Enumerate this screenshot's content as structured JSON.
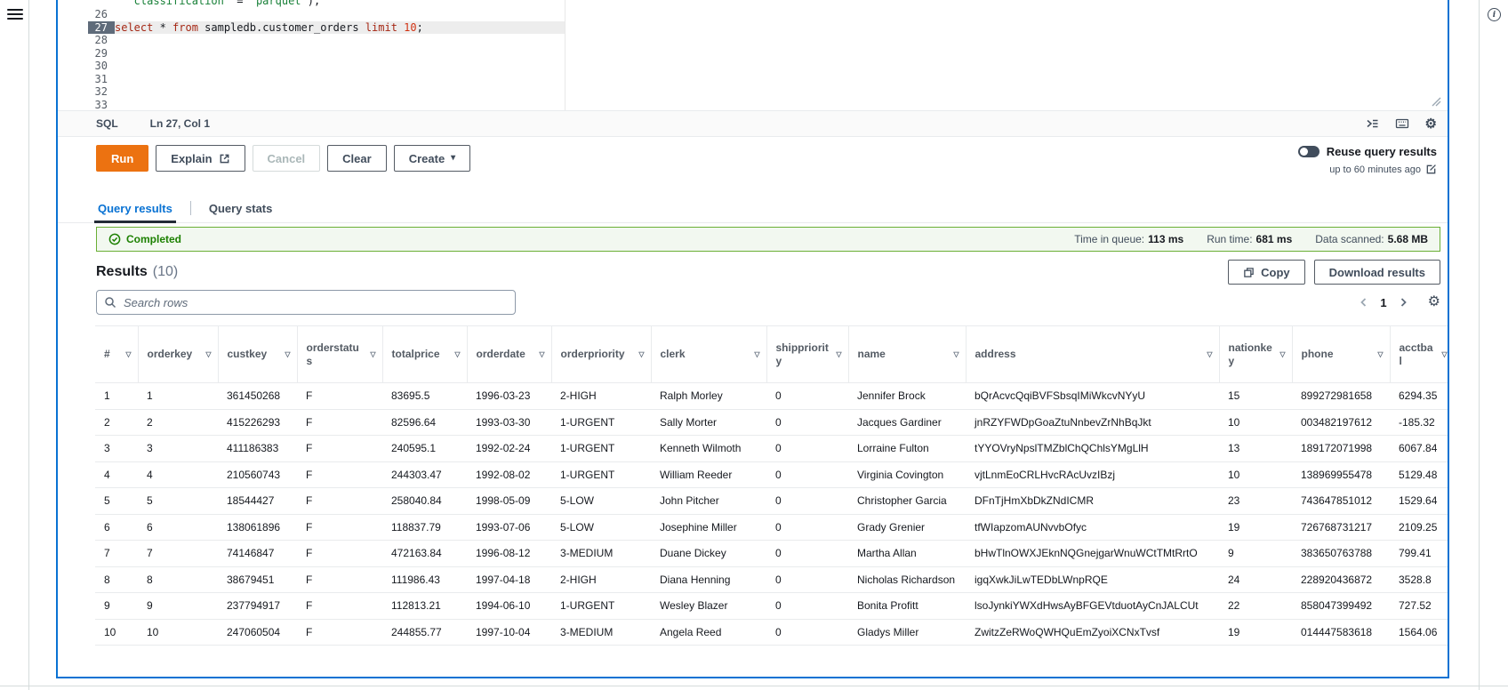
{
  "icons": {
    "settings_gear": "⚙",
    "column_filter": "▽",
    "caret_down": "▾",
    "info": "i"
  },
  "colors": {
    "panel_focus_blue": "#0972d3",
    "run_button_orange": "#ec7211",
    "success_green": "#1d8102",
    "active_tab_blue": "#0972d3",
    "sql_keyword": "#a52714",
    "sql_string": "#188038",
    "sql_number": "#d13212"
  },
  "editor": {
    "partial_line_tokens": [
      {
        "c": "str",
        "v": "  'classification'"
      },
      {
        "c": "pl",
        "v": " = "
      },
      {
        "c": "str",
        "v": "'parquet'"
      },
      {
        "c": "pl",
        "v": ");"
      }
    ],
    "line_before": "26",
    "active_line_number": "27",
    "active_line_tokens": [
      {
        "c": "kw",
        "v": "select"
      },
      {
        "c": "pl",
        "v": " * "
      },
      {
        "c": "kw",
        "v": "from"
      },
      {
        "c": "pl",
        "v": " sampledb.customer_orders "
      },
      {
        "c": "kw",
        "v": "limit"
      },
      {
        "c": "pl",
        "v": " "
      },
      {
        "c": "num",
        "v": "10"
      },
      {
        "c": "pl",
        "v": ";"
      }
    ],
    "lines_below": [
      "28",
      "29",
      "30",
      "31",
      "32",
      "33"
    ],
    "statusbar": {
      "language": "SQL",
      "cursor_position": "Ln 27, Col 1"
    }
  },
  "actions": {
    "run": "Run",
    "explain": "Explain",
    "cancel": "Cancel",
    "clear": "Clear",
    "create": "Create",
    "reuse_label": "Reuse query results",
    "reuse_sublabel": "up to 60 minutes ago"
  },
  "tabs": {
    "query_results": "Query results",
    "query_stats": "Query stats"
  },
  "banner": {
    "status": "Completed",
    "stats": [
      {
        "label": "Time in queue:",
        "value": "113 ms"
      },
      {
        "label": "Run time:",
        "value": "681 ms"
      },
      {
        "label": "Data scanned:",
        "value": "5.68 MB"
      }
    ]
  },
  "results": {
    "title": "Results",
    "count": "(10)",
    "copy": "Copy",
    "download": "Download results",
    "search_placeholder": "Search rows",
    "page": "1"
  },
  "table": {
    "columns": [
      "#",
      "orderkey",
      "custkey",
      "orderstatus",
      "totalprice",
      "orderdate",
      "orderpriority",
      "clerk",
      "shippriority",
      "name",
      "address",
      "nationkey",
      "phone",
      "acctbal"
    ],
    "rows": [
      [
        "1",
        "1",
        "361450268",
        "F",
        "83695.5",
        "1996-03-23",
        "2-HIGH",
        "Ralph Morley",
        "0",
        "Jennifer Brock",
        "bQrAcvcQqiBVFSbsqIMiWkcvNYyU",
        "15",
        "899272981658",
        "6294.35"
      ],
      [
        "2",
        "2",
        "415226293",
        "F",
        "82596.64",
        "1993-03-30",
        "1-URGENT",
        "Sally Morter",
        "0",
        "Jacques Gardiner",
        "jnRZYFWDpGoaZtuNnbevZrNhBqJkt",
        "10",
        "003482197612",
        "-185.32"
      ],
      [
        "3",
        "3",
        "411186383",
        "F",
        "240595.1",
        "1992-02-24",
        "1-URGENT",
        "Kenneth Wilmoth",
        "0",
        "Lorraine Fulton",
        "tYYOVryNpslTMZblChQChlsYMgLlH",
        "13",
        "189172071998",
        "6067.84"
      ],
      [
        "4",
        "4",
        "210560743",
        "F",
        "244303.47",
        "1992-08-02",
        "1-URGENT",
        "William Reeder",
        "0",
        "Virginia Covington",
        "vjtLnmEoCRLHvcRAcUvzIBzj",
        "10",
        "138969955478",
        "5129.48"
      ],
      [
        "5",
        "5",
        "18544427",
        "F",
        "258040.84",
        "1998-05-09",
        "5-LOW",
        "John Pitcher",
        "0",
        "Christopher Garcia",
        "DFnTjHmXbDkZNdICMR",
        "23",
        "743647851012",
        "1529.64"
      ],
      [
        "6",
        "6",
        "138061896",
        "F",
        "118837.79",
        "1993-07-06",
        "5-LOW",
        "Josephine Miller",
        "0",
        "Grady Grenier",
        "tfWIapzomAUNvvbOfyc",
        "19",
        "726768731217",
        "2109.25"
      ],
      [
        "7",
        "7",
        "74146847",
        "F",
        "472163.84",
        "1996-08-12",
        "3-MEDIUM",
        "Duane Dickey",
        "0",
        "Martha Allan",
        "bHwTlnOWXJEknNQGnejgarWnuWCtTMtRrtO",
        "9",
        "383650763788",
        "799.41"
      ],
      [
        "8",
        "8",
        "38679451",
        "F",
        "111986.43",
        "1997-04-18",
        "2-HIGH",
        "Diana Henning",
        "0",
        "Nicholas Richardson",
        "igqXwkJiLwTEDbLWnpRQE",
        "24",
        "228920436872",
        "3528.8"
      ],
      [
        "9",
        "9",
        "237794917",
        "F",
        "112813.21",
        "1994-06-10",
        "1-URGENT",
        "Wesley Blazer",
        "0",
        "Bonita Profitt",
        "lsoJynkiYWXdHwsAyBFGEVtduotAyCnJALCUt",
        "22",
        "858047399492",
        "727.52"
      ],
      [
        "10",
        "10",
        "247060504",
        "F",
        "244855.77",
        "1997-10-04",
        "3-MEDIUM",
        "Angela Reed",
        "0",
        "Gladys Miller",
        "ZwitzZeRWoQWHQuEmZyoiXCNxTvsf",
        "19",
        "014447583618",
        "1564.06"
      ]
    ]
  }
}
